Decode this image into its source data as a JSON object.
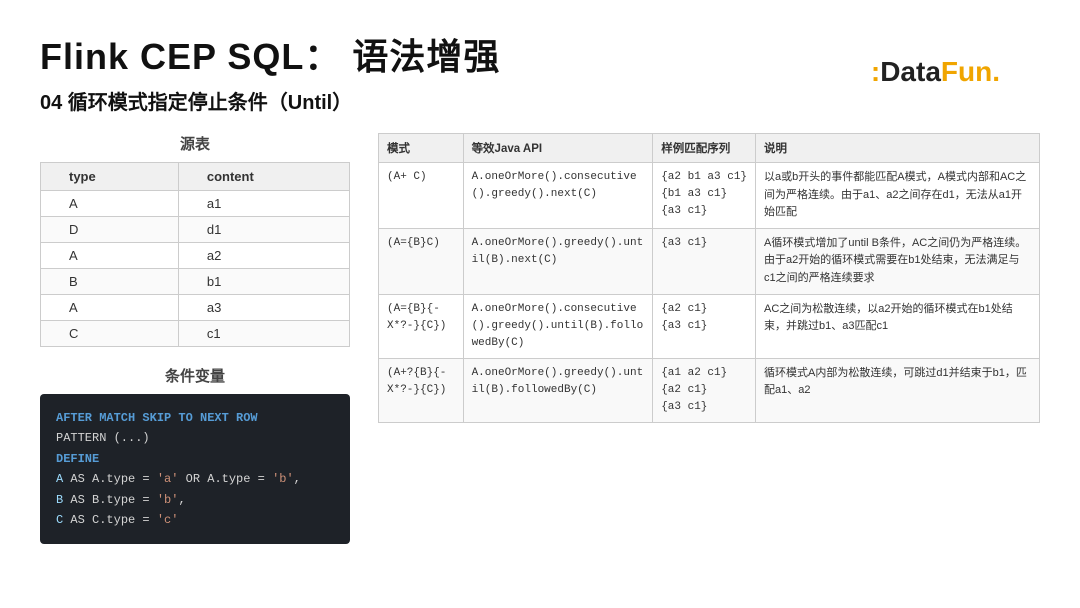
{
  "header": {
    "title": "Flink CEP SQL： 语法增强",
    "subtitle": "04 循环模式指定停止条件（Until）"
  },
  "logo": {
    "text": ":DataFun."
  },
  "left": {
    "source_label": "源表",
    "source_table": {
      "headers": [
        "type",
        "content"
      ],
      "rows": [
        [
          "A",
          "a1"
        ],
        [
          "D",
          "d1"
        ],
        [
          "A",
          "a2"
        ],
        [
          "B",
          "b1"
        ],
        [
          "A",
          "a3"
        ],
        [
          "C",
          "c1"
        ]
      ]
    },
    "condition_label": "条件变量",
    "code_lines": [
      {
        "type": "kw",
        "text": "AFTER MATCH SKIP TO NEXT ROW"
      },
      {
        "type": "plain",
        "text": "PATTERN (...)"
      },
      {
        "type": "kw",
        "text": "DEFINE"
      },
      {
        "type": "mixed",
        "parts": [
          {
            "t": "id",
            "v": "A"
          },
          {
            "t": "plain",
            "v": " AS A.type = "
          },
          {
            "t": "str",
            "v": "'a'"
          },
          {
            "t": "plain",
            "v": " OR A.type = "
          },
          {
            "t": "str",
            "v": "'b'"
          },
          {
            "t": "plain",
            "v": ","
          }
        ]
      },
      {
        "type": "mixed",
        "parts": [
          {
            "t": "id",
            "v": "B"
          },
          {
            "t": "plain",
            "v": " AS B.type = "
          },
          {
            "t": "str",
            "v": "'b'"
          },
          {
            "t": "plain",
            "v": ","
          }
        ]
      },
      {
        "type": "mixed",
        "parts": [
          {
            "t": "id",
            "v": "C"
          },
          {
            "t": "plain",
            "v": " AS C.type = "
          },
          {
            "t": "str",
            "v": "'c'"
          }
        ]
      }
    ]
  },
  "right": {
    "table": {
      "headers": [
        "模式",
        "等效Java API",
        "样例匹配序列",
        "说明"
      ],
      "rows": [
        {
          "pattern": "(A+ C)",
          "api": "A.oneOrMore().consecutive().greedy().next(C)",
          "examples": "{a2 b1 a3 c1}\n{b1 a3 c1}\n{a3 c1}",
          "desc": "以a或b开头的事件都能匹配A模式，A模式内部和AC之间为严格连续。由于a1、a2之间存在d1，无法从a1开始匹配"
        },
        {
          "pattern": "(A={B}C)",
          "api": "A.oneOrMore().greedy().until(B).next(C)",
          "examples": "{a3 c1}",
          "desc": "A循环模式增加了until B条件，AC之间仍为严格连续。由于a2开始的循环模式需要在b1处结束，无法满足与c1之间的严格连续要求"
        },
        {
          "pattern": "(A={B}{-X*?-}{C})",
          "api": "A.oneOrMore().consecutive().greedy().until(B).followedBy(C)",
          "examples": "{a2 c1}\n{a3 c1}",
          "desc": "AC之间为松散连续，以a2开始的循环模式在b1处结束，并跳过b1、a3匹配c1"
        },
        {
          "pattern": "(A+?{B}{-X*?-}{C})",
          "api": "A.oneOrMore().greedy().until(B).followedBy(C)",
          "examples": "{a1 a2 c1}\n{a2 c1}\n{a3 c1}",
          "desc": "循环模式A内部为松散连续，可跳过d1并结束于b1，匹配a1、a2"
        }
      ]
    }
  }
}
